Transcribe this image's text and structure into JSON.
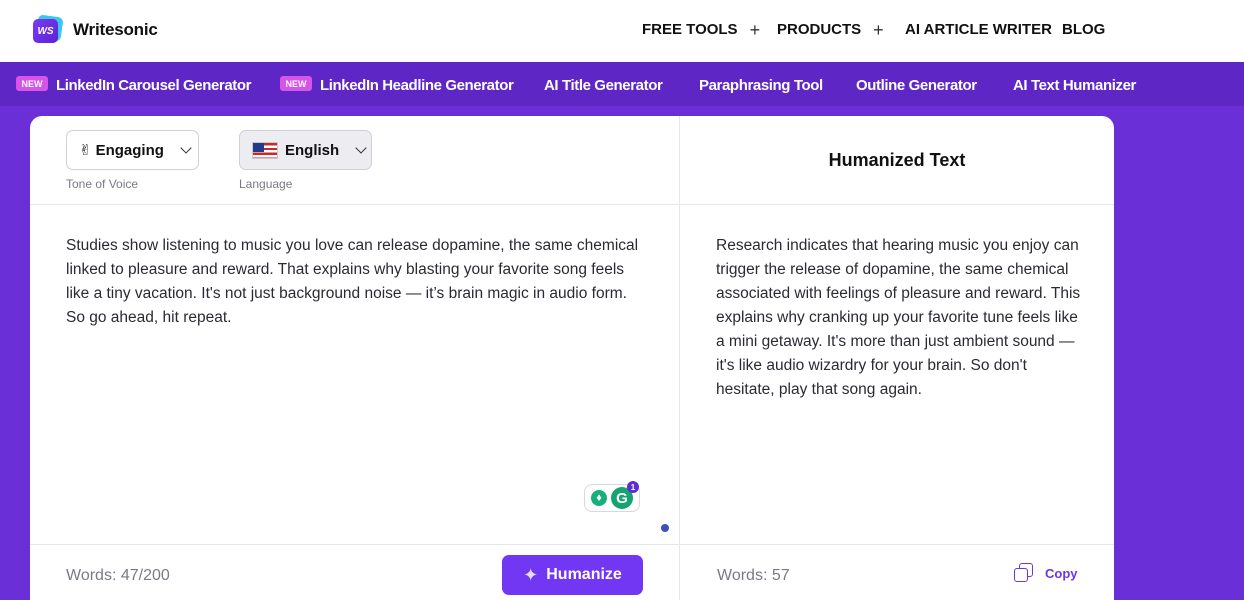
{
  "header": {
    "logo_text": "WS",
    "brand": "Writesonic",
    "nav": [
      {
        "label": "FREE TOOLS",
        "has_plus": true
      },
      {
        "label": "PRODUCTS",
        "has_plus": true
      },
      {
        "label": "AI ARTICLE WRITER",
        "has_plus": false
      },
      {
        "label": "BLOG",
        "has_plus": false
      }
    ],
    "plus_glyph": "+"
  },
  "tool_strip": {
    "badge_text": "NEW",
    "items": [
      {
        "label": "LinkedIn Carousel Generator",
        "is_new": true
      },
      {
        "label": "LinkedIn Headline Generator",
        "is_new": true
      },
      {
        "label": "AI Title Generator",
        "is_new": false
      },
      {
        "label": "Paraphrasing Tool",
        "is_new": false
      },
      {
        "label": "Outline Generator",
        "is_new": false
      },
      {
        "label": "AI Text Humanizer",
        "is_new": false
      }
    ]
  },
  "input_panel": {
    "tone": {
      "value": "Engaging",
      "emoji": "✌",
      "label": "Tone of Voice"
    },
    "language": {
      "value": "English",
      "label": "Language",
      "flag_icon": "us-flag-icon"
    },
    "text": "Studies show listening to music you love can release dopamine, the same chemical linked to pleasure and reward. That explains why blasting your favorite song feels like a tiny vacation. It's not just background noise — it’s brain magic in audio form. So go ahead, hit repeat.",
    "word_count": "Words: 47/200",
    "humanize_button": "Humanize",
    "grammarly": {
      "count": "1",
      "letter": "G",
      "bulb": "♦"
    }
  },
  "output_panel": {
    "title": "Humanized Text",
    "text": "Research indicates that hearing music you enjoy can trigger the release of dopamine, the same chemical associated with feelings of pleasure and reward. This explains why cranking up your favorite tune feels like a mini getaway. It's more than just ambient sound — it's like audio wizardry for your brain. So don't hesitate, play that song again.",
    "word_count": "Words: 57",
    "copy_button": "Copy"
  },
  "colors": {
    "accent": "#7137f2",
    "background": "#6a2fd6",
    "strip": "#5e26c4",
    "new_badge": "#d654e8"
  }
}
